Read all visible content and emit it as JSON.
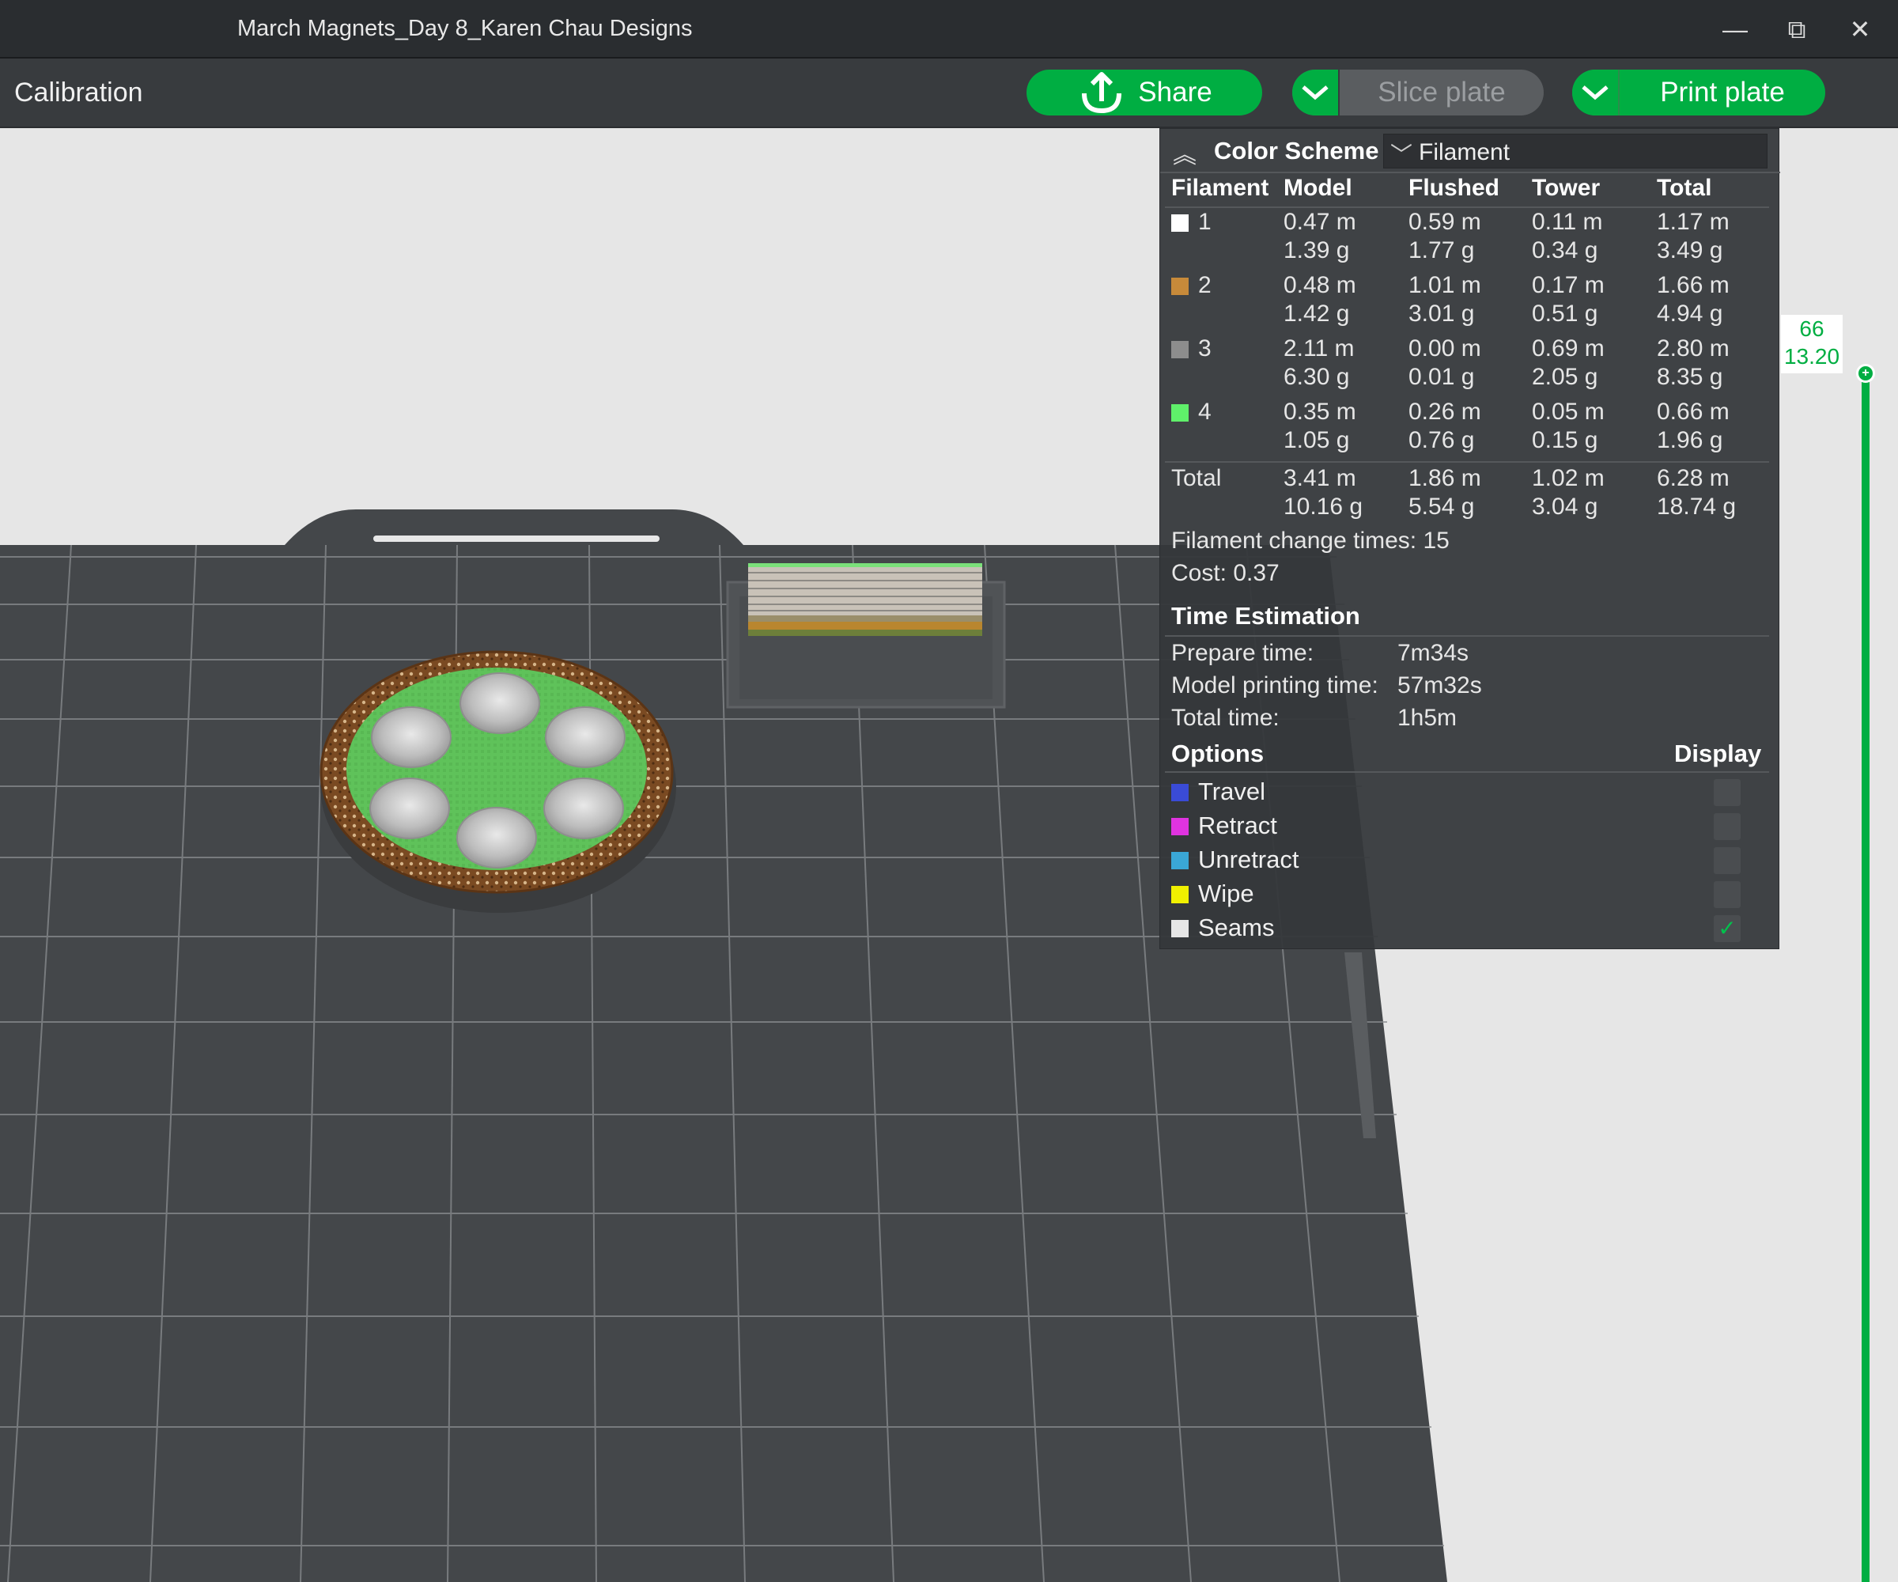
{
  "window": {
    "title": "March Magnets_Day 8_Karen Chau Designs",
    "minimize": "—",
    "restore": "⧉",
    "close": "✕"
  },
  "toolbar": {
    "calibration": "Calibration",
    "share": "Share",
    "slice": "Slice plate",
    "print": "Print plate"
  },
  "panel": {
    "color_scheme_label": "Color Scheme",
    "color_scheme_value": "Filament",
    "headers": [
      "Filament",
      "Model",
      "Flushed",
      "Tower",
      "Total"
    ],
    "filaments": [
      {
        "id": "1",
        "color": "#ffffff",
        "model": [
          "0.47 m",
          "1.39 g"
        ],
        "flushed": [
          "0.59 m",
          "1.77 g"
        ],
        "tower": [
          "0.11 m",
          "0.34 g"
        ],
        "total": [
          "1.17 m",
          "3.49 g"
        ]
      },
      {
        "id": "2",
        "color": "#c78a3a",
        "model": [
          "0.48 m",
          "1.42 g"
        ],
        "flushed": [
          "1.01 m",
          "3.01 g"
        ],
        "tower": [
          "0.17 m",
          "0.51 g"
        ],
        "total": [
          "1.66 m",
          "4.94 g"
        ]
      },
      {
        "id": "3",
        "color": "#8d8d8d",
        "model": [
          "2.11 m",
          "6.30 g"
        ],
        "flushed": [
          "0.00 m",
          "0.01 g"
        ],
        "tower": [
          "0.69 m",
          "2.05 g"
        ],
        "total": [
          "2.80 m",
          "8.35 g"
        ]
      },
      {
        "id": "4",
        "color": "#5ff06a",
        "model": [
          "0.35 m",
          "1.05 g"
        ],
        "flushed": [
          "0.26 m",
          "0.76 g"
        ],
        "tower": [
          "0.05 m",
          "0.15 g"
        ],
        "total": [
          "0.66 m",
          "1.96 g"
        ]
      }
    ],
    "total": {
      "label": "Total",
      "model": [
        "3.41 m",
        "10.16 g"
      ],
      "flushed": [
        "1.86 m",
        "5.54 g"
      ],
      "tower": [
        "1.02 m",
        "3.04 g"
      ],
      "total": [
        "6.28 m",
        "18.74 g"
      ]
    },
    "filament_change": "Filament change times: 15",
    "cost": "Cost: 0.37",
    "time_title": "Time Estimation",
    "prepare_label": "Prepare time:",
    "prepare_value": "7m34s",
    "model_label": "Model printing time:",
    "model_value": "57m32s",
    "total_label": "Total time:",
    "total_value": "1h5m",
    "options_label": "Options",
    "display_label": "Display",
    "options": [
      {
        "name": "Travel",
        "color": "#3a4bd6",
        "checked": false
      },
      {
        "name": "Retract",
        "color": "#e033e0",
        "checked": false
      },
      {
        "name": "Unretract",
        "color": "#3aa7d6",
        "checked": false
      },
      {
        "name": "Wipe",
        "color": "#f0f000",
        "checked": false
      },
      {
        "name": "Seams",
        "color": "#e6e6e6",
        "checked": true
      }
    ]
  },
  "layer_slider": {
    "layer": "66",
    "height": "13.20"
  },
  "colors": {
    "accent": "#00ae42",
    "bed": "#44474a",
    "grid": "#8a8d90",
    "disc_green": "#5fc25a",
    "disc_rim": "#7a4a22"
  }
}
